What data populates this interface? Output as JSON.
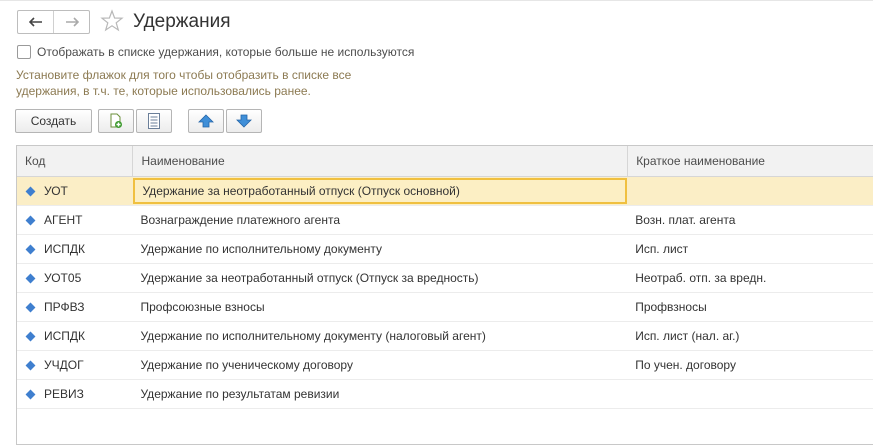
{
  "window": {
    "title": "Удержания"
  },
  "nav": {
    "back_icon": "arrow-left-icon",
    "forward_icon": "arrow-right-icon",
    "favorite_icon": "star-icon"
  },
  "filter": {
    "checkbox_label": "Отображать в списке удержания, которые больше не используются",
    "checked": false,
    "hint_line1": "Установите флажок для того чтобы отобразить в списке все",
    "hint_line2": "удержания, в т.ч. те, которые использовались ранее."
  },
  "toolbar": {
    "create_label": "Создать",
    "copy_icon": "copy-add-icon",
    "list_icon": "list-icon",
    "up_icon": "arrow-up-icon",
    "down_icon": "arrow-down-icon"
  },
  "table": {
    "columns": [
      "Код",
      "Наименование",
      "Краткое наименование"
    ],
    "rows": [
      {
        "code": "УОТ",
        "name": "Удержание за неотработанный отпуск (Отпуск основной)",
        "short": "",
        "selected": true
      },
      {
        "code": "АГЕНТ",
        "name": "Вознаграждение платежного агента",
        "short": "Возн. плат. агента"
      },
      {
        "code": "ИСПДК",
        "name": "Удержание по исполнительному документу",
        "short": "Исп. лист"
      },
      {
        "code": "УОТ05",
        "name": "Удержание за неотработанный отпуск (Отпуск за вредность)",
        "short": "Неотраб. отп. за вредн."
      },
      {
        "code": "ПРФВЗ",
        "name": "Профсоюзные взносы",
        "short": "Профвзносы"
      },
      {
        "code": "ИСПДК",
        "name": "Удержание по исполнительному документу (налоговый агент)",
        "short": "Исп. лист (нал. аг.)"
      },
      {
        "code": "УЧДОГ",
        "name": "Удержание по ученическому договору",
        "short": "По учен. договору"
      },
      {
        "code": "РЕВИЗ",
        "name": "Удержание по результатам ревизии",
        "short": ""
      }
    ]
  },
  "colors": {
    "accent": "#3f7fcf",
    "selection": "#fbeec6",
    "selection_border": "#f0c040",
    "hint": "#8c7a52"
  }
}
